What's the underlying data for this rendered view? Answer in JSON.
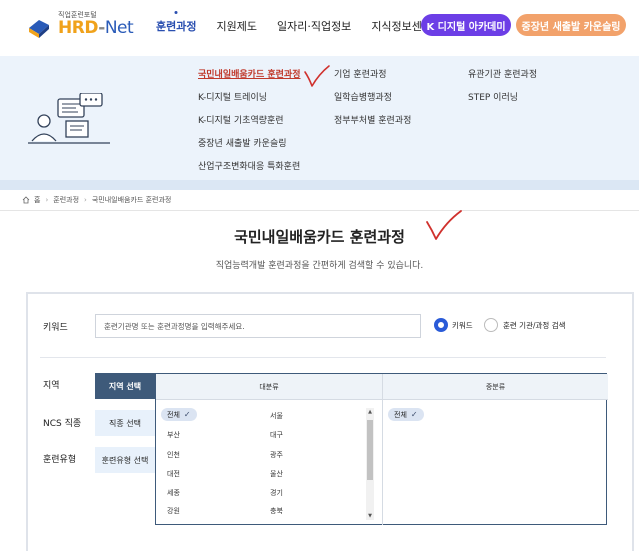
{
  "logo": {
    "subtitle": "직업훈련포털",
    "hrd": "HRD",
    "dash": "-",
    "net": "Net"
  },
  "gnb": {
    "items": [
      "훈련과정",
      "지원제도",
      "일자리·직업정보",
      "지식정보센터"
    ],
    "kdigital_label": "K 디지털 아카데미",
    "counsel_label": "중장년 새출발 카운슬링"
  },
  "mega_menu": {
    "col1": [
      "국민내일배움카드 훈련과정",
      "K-디지털 트레이닝",
      "K-디지털 기초역량훈련",
      "중장년 새출발 카운슬링",
      "산업구조변화대응 특화훈련"
    ],
    "col2": [
      "기업 훈련과정",
      "일학습병행과정",
      "정부부처별 훈련과정"
    ],
    "col3": [
      "유관기관 훈련과정",
      "STEP 이러닝"
    ]
  },
  "breadcrumb": {
    "home": "홈",
    "level1": "훈련과정",
    "level2": "국민내일배움카드 훈련과정"
  },
  "page": {
    "title": "국민내일배움카드 훈련과정",
    "description": "직업능력개발 훈련과정을 간편하게 검색할 수 있습니다."
  },
  "search": {
    "keyword_label": "키워드",
    "keyword_placeholder": "훈련기관명 또는 훈련과정명을 입력해주세요.",
    "radio_keyword": "키워드",
    "radio_institution": "훈련 기관/과정 검색",
    "region_label": "지역",
    "ncs_label": "NCS 직종",
    "type_label": "훈련유형",
    "region_btn": "지역 선택",
    "ncs_btn": "직종 선택",
    "type_btn": "훈련유형 선택",
    "main_header": "대분류",
    "sub_header": "중분류",
    "all_chip": "전체",
    "sub_all_chip": "전체",
    "regions_left": [
      "부산",
      "인천",
      "대전",
      "세종",
      "강원"
    ],
    "regions_right": [
      "서울",
      "대구",
      "광주",
      "울산",
      "경기",
      "충북"
    ]
  },
  "colors": {
    "accent": "#2a4fb0",
    "kdigital": "#6c3ee6",
    "counsel": "#f2a26b",
    "annotation": "#d0312d"
  }
}
